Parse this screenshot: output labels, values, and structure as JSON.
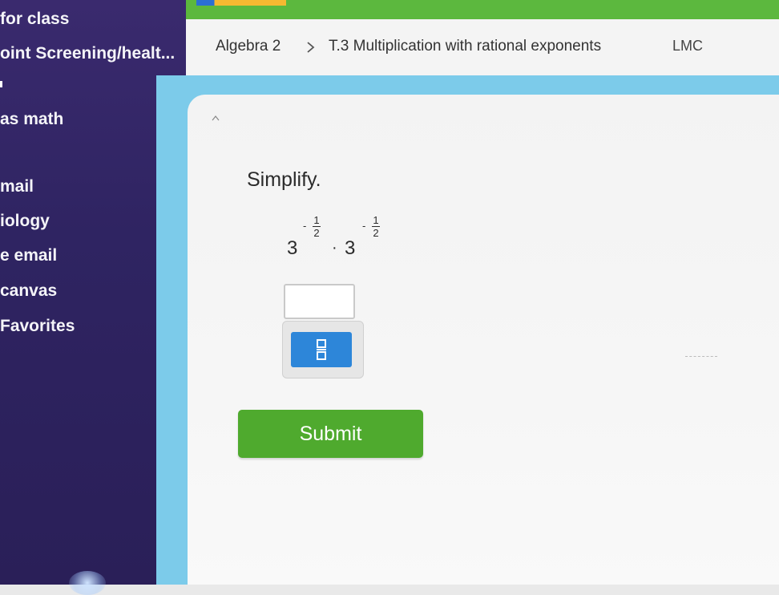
{
  "sidebar": {
    "items": [
      {
        "label": "for class"
      },
      {
        "label": "oint Screening/healt..."
      },
      {
        "label": "as math"
      },
      {
        "label": "mail"
      },
      {
        "label": "iology"
      },
      {
        "label": "e email"
      },
      {
        "label": "canvas"
      },
      {
        "label": "Favorites"
      }
    ]
  },
  "breadcrumb": {
    "course": "Algebra 2",
    "skill": "T.3 Multiplication with rational exponents",
    "code": "LMC"
  },
  "question": {
    "prompt": "Simplify.",
    "term1_base": "3",
    "term1_exp_sign": "-",
    "term1_exp_num": "1",
    "term1_exp_den": "2",
    "operator": "·",
    "term2_base": "3",
    "term2_exp_sign": "-",
    "term2_exp_num": "1",
    "term2_exp_den": "2"
  },
  "answer": {
    "value": ""
  },
  "submit_label": "Submit",
  "colors": {
    "sidebar": "#2f2462",
    "topbar_green": "#5cb83e",
    "backdrop_blue": "#7ccbea",
    "fraction_button": "#2d86d9",
    "submit_green": "#4faa2e"
  }
}
